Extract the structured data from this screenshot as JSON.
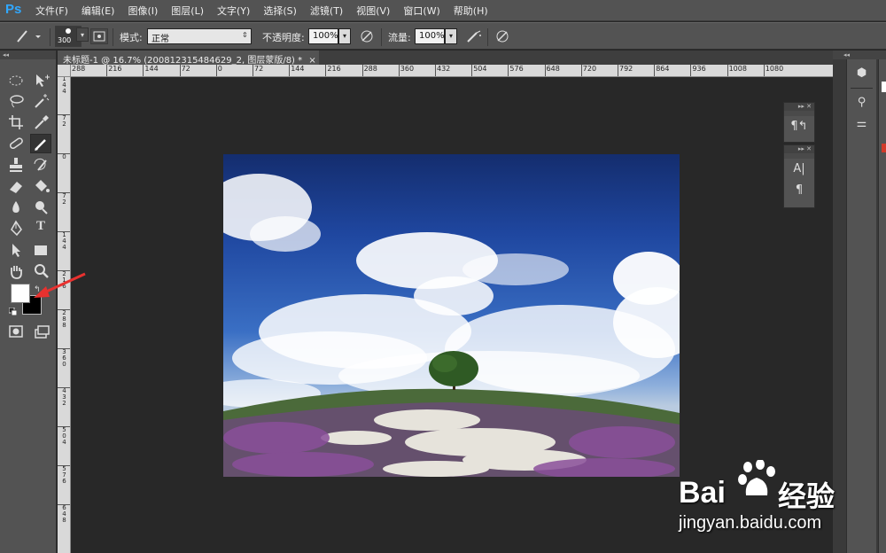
{
  "app": {
    "logo": "Ps"
  },
  "menu": [
    "文件(F)",
    "编辑(E)",
    "图像(I)",
    "图层(L)",
    "文字(Y)",
    "选择(S)",
    "滤镜(T)",
    "视图(V)",
    "窗口(W)",
    "帮助(H)"
  ],
  "options": {
    "brush_size": "300",
    "mode_label": "模式:",
    "mode_value": "正常",
    "opacity_label": "不透明度:",
    "opacity_value": "100%",
    "flow_label": "流量:",
    "flow_value": "100%"
  },
  "document": {
    "tab_title": "未标题-1 @ 16.7% (20081231548462​9_2, 图层蒙版/8) *",
    "close": "×"
  },
  "ruler_top": [
    "288",
    "216",
    "144",
    "72",
    "0",
    "72",
    "144",
    "216",
    "288",
    "360",
    "432",
    "504",
    "576",
    "648",
    "720",
    "792",
    "864",
    "936",
    "1008",
    "1080"
  ],
  "ruler_left": [
    "1\n4\n4",
    "7\n2",
    "0",
    "7\n2",
    "1\n4\n4",
    "2\n1\n6",
    "2\n8\n8",
    "3\n6\n0",
    "4\n3\n2",
    "5\n0\n4",
    "5\n7\n6",
    "6\n4\n8"
  ],
  "panels": {
    "icon_names": [
      "paragraph-styles-icon",
      "character-icon",
      "paragraph-icon"
    ]
  },
  "watermark": {
    "brand": "Bai",
    "brand2": "经验",
    "url": "jingyan.baidu.com"
  },
  "colors": {
    "accent": "#31a8ff",
    "annotation_arrow": "#e8312f",
    "foreground": "#ffffff",
    "background": "#000000"
  }
}
